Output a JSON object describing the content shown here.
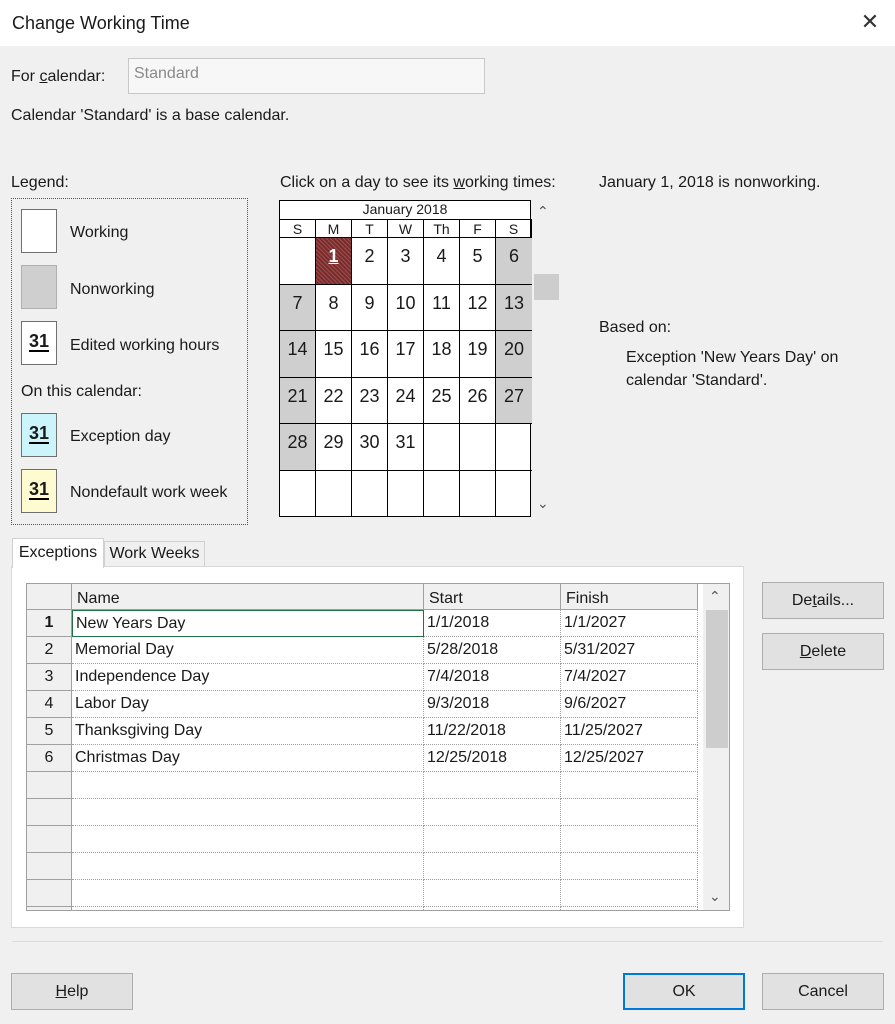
{
  "window": {
    "title": "Change Working Time"
  },
  "for_calendar": {
    "label_pre": "For ",
    "label_key": "c",
    "label_post": "alendar:",
    "value": "Standard"
  },
  "base_note": "Calendar 'Standard' is a base calendar.",
  "legend": {
    "title": "Legend:",
    "working": "Working",
    "nonworking": "Nonworking",
    "edited": "Edited working hours",
    "sample_day": "31",
    "on_this_calendar": "On this calendar:",
    "exception": "Exception day",
    "nondefault": "Nondefault work week",
    "colors": {
      "working": "#ffffff",
      "nonworking": "#cfcfcf",
      "exception": "#ccf5fb",
      "nondefault": "#fffbd0"
    }
  },
  "calendar": {
    "instruction_pre": "Click on a day to see its ",
    "instruction_key": "w",
    "instruction_post": "orking times:",
    "month": "January 2018",
    "day_headers": [
      "S",
      "M",
      "T",
      "W",
      "Th",
      "F",
      "S"
    ],
    "weeks": [
      [
        "",
        "1",
        "2",
        "3",
        "4",
        "5",
        "6"
      ],
      [
        "7",
        "8",
        "9",
        "10",
        "11",
        "12",
        "13"
      ],
      [
        "14",
        "15",
        "16",
        "17",
        "18",
        "19",
        "20"
      ],
      [
        "21",
        "22",
        "23",
        "24",
        "25",
        "26",
        "27"
      ],
      [
        "28",
        "29",
        "30",
        "31",
        "",
        "",
        ""
      ],
      [
        "",
        "",
        "",
        "",
        "",
        "",
        ""
      ]
    ],
    "selected_day": "1"
  },
  "status": {
    "text": "January 1, 2018 is nonworking.",
    "based_on_label": "Based on:",
    "based_on_detail": "Exception 'New Years Day' on calendar 'Standard'."
  },
  "tabs": [
    {
      "label": "Exceptions",
      "active": true
    },
    {
      "label": "Work Weeks",
      "active": false
    }
  ],
  "grid": {
    "headers": [
      "Name",
      "Start",
      "Finish"
    ],
    "rows": [
      {
        "num": "1",
        "name": "New Years Day",
        "start": "1/1/2018",
        "finish": "1/1/2027"
      },
      {
        "num": "2",
        "name": "Memorial Day",
        "start": "5/28/2018",
        "finish": "5/31/2027"
      },
      {
        "num": "3",
        "name": "Independence Day",
        "start": "7/4/2018",
        "finish": "7/4/2027"
      },
      {
        "num": "4",
        "name": "Labor Day",
        "start": "9/3/2018",
        "finish": "9/6/2027"
      },
      {
        "num": "5",
        "name": "Thanksgiving Day",
        "start": "11/22/2018",
        "finish": "11/25/2027"
      },
      {
        "num": "6",
        "name": "Christmas Day",
        "start": "12/25/2018",
        "finish": "12/25/2027"
      }
    ],
    "empty_rows": 6
  },
  "buttons": {
    "details_pre": "De",
    "details_key": "t",
    "details_post": "ails...",
    "delete_key": "D",
    "delete_post": "elete",
    "help_key": "H",
    "help_post": "elp",
    "ok": "OK",
    "cancel": "Cancel"
  }
}
